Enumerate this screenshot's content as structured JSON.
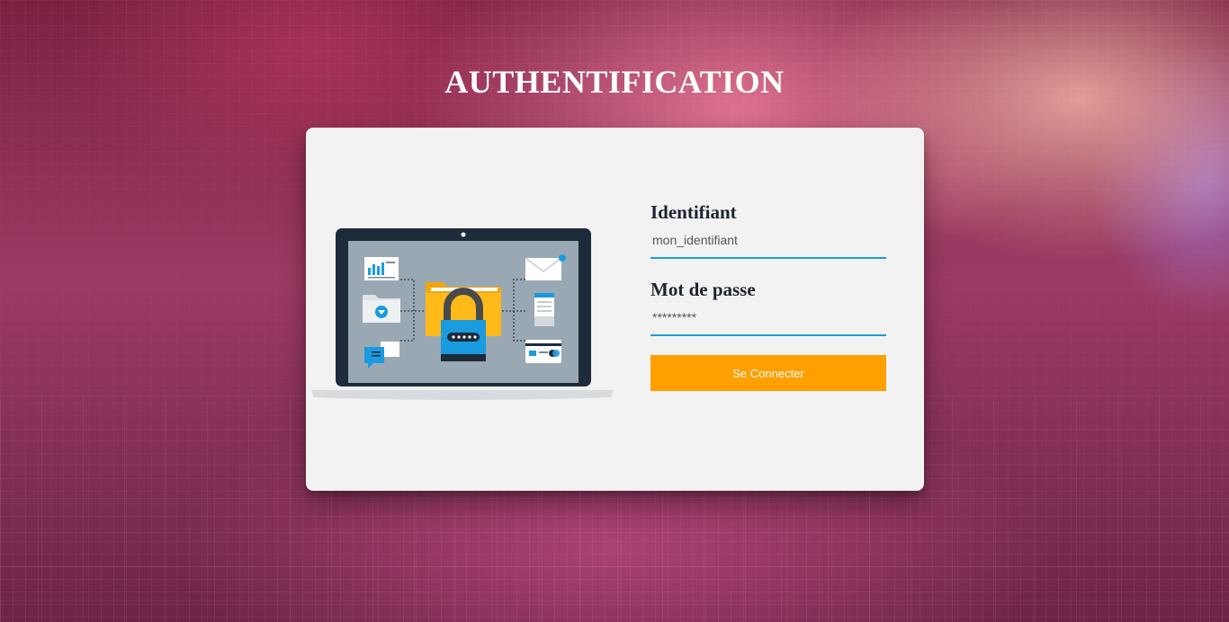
{
  "page": {
    "title": "AUTHENTIFICATION"
  },
  "form": {
    "username": {
      "label": "Identifiant",
      "placeholder": "mon_identifiant"
    },
    "password": {
      "label": "Mot de passe",
      "placeholder": "*********"
    },
    "submit_label": "Se Connecter"
  },
  "illustration": {
    "icons": [
      "laptop-icon",
      "chart-document-icon",
      "folder-download-icon",
      "chat-icon",
      "padlock-folder-icon",
      "envelope-icon",
      "phone-icon",
      "credit-card-icon"
    ]
  },
  "colors": {
    "accent": "#ff9f00",
    "input_underline": "#1a9be0",
    "card_background": "#f2f2f2",
    "label_text": "#1c2430"
  }
}
